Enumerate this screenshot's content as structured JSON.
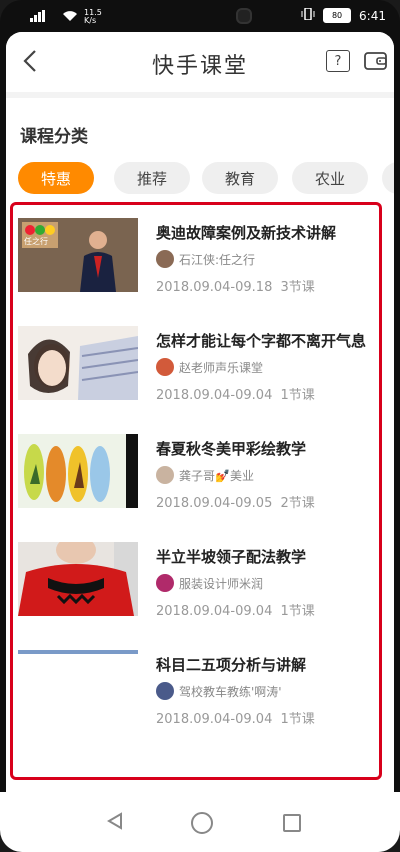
{
  "status_bar": {
    "network": "4G",
    "speed": "11.5 K/s",
    "time": "6:41",
    "battery": "80"
  },
  "header": {
    "title": "快手课堂",
    "help_icon": "question-icon",
    "wallet_icon": "wallet-icon"
  },
  "section": {
    "title": "课程分类"
  },
  "categories": [
    {
      "label": "特惠",
      "active": true
    },
    {
      "label": "推荐",
      "active": false
    },
    {
      "label": "教育",
      "active": false
    },
    {
      "label": "农业",
      "active": false
    }
  ],
  "courses": [
    {
      "title": "奥迪故障案例及新技术讲解",
      "author": "石江侠:任之行",
      "dates": "2018.09.04-09.18",
      "lessons": "3节课",
      "thumb_text": "任之行"
    },
    {
      "title": "怎样才能让每个字都不离开气息",
      "author": "赵老师声乐课堂",
      "dates": "2018.09.04-09.04",
      "lessons": "1节课"
    },
    {
      "title": "春夏秋冬美甲彩绘教学",
      "author": "龚子哥💅美业",
      "dates": "2018.09.04-09.05",
      "lessons": "2节课"
    },
    {
      "title": "半立半坡领子配法教学",
      "author": "服装设计师米润",
      "dates": "2018.09.04-09.04",
      "lessons": "1节课"
    },
    {
      "title": "科目二五项分析与讲解",
      "author": "驾校教车教练'啊涛'",
      "dates": "2018.09.04-09.04",
      "lessons": "1节课"
    }
  ],
  "colors": {
    "accent": "#ff8a00",
    "highlight_frame": "#d8001b"
  }
}
